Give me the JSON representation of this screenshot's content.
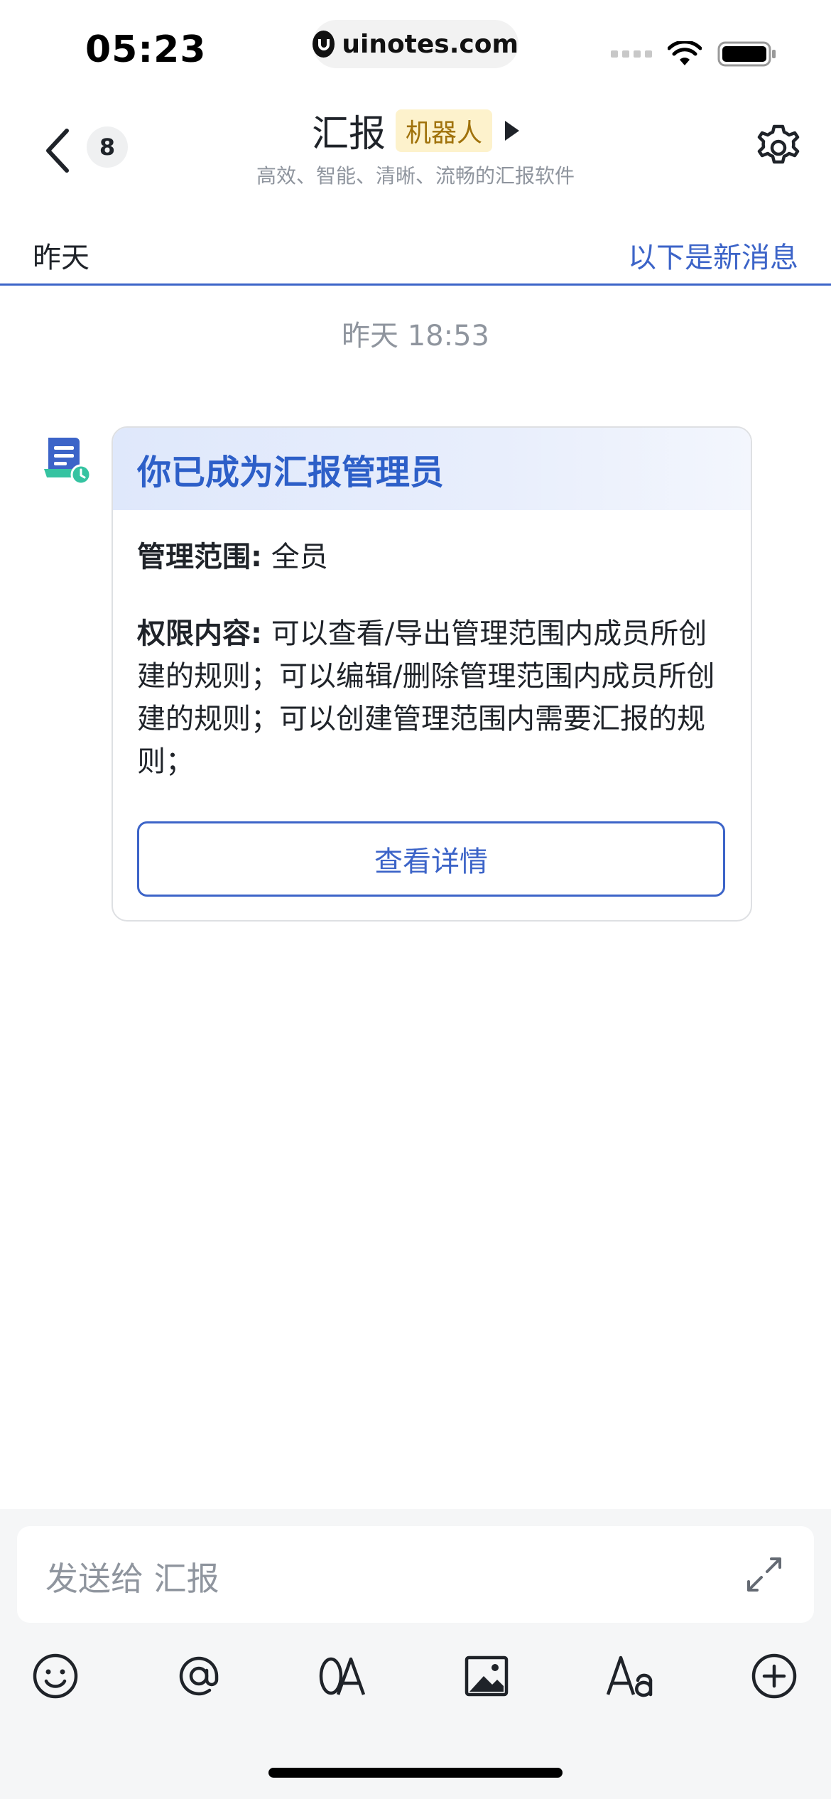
{
  "status_bar": {
    "time": "05:23",
    "url": "uinotes.com"
  },
  "header": {
    "unread_count": "8",
    "title": "汇报",
    "tag": "机器人",
    "subtitle": "高效、智能、清晰、流畅的汇报软件"
  },
  "divider": {
    "left_label": "昨天",
    "right_label": "以下是新消息"
  },
  "timestamp": "昨天 18:53",
  "card": {
    "title": "你已成为汇报管理员",
    "scope_label": "管理范围:",
    "scope_value": "全员",
    "permission_label": "权限内容:",
    "permission_value": "可以查看/导出管理范围内成员所创建的规则；可以编辑/删除管理范围内成员所创建的规则；可以创建管理范围内需要汇报的规则；",
    "button_label": "查看详情"
  },
  "composer": {
    "placeholder": "发送给 汇报"
  },
  "toolbar_icons": [
    "emoji-icon",
    "mention-icon",
    "ocr-icon",
    "image-icon",
    "text-format-icon",
    "plus-icon"
  ],
  "colors": {
    "accent": "#3c64c8",
    "bot_tag_bg": "#fdf2cc",
    "bot_tag_text": "#a0720b"
  }
}
